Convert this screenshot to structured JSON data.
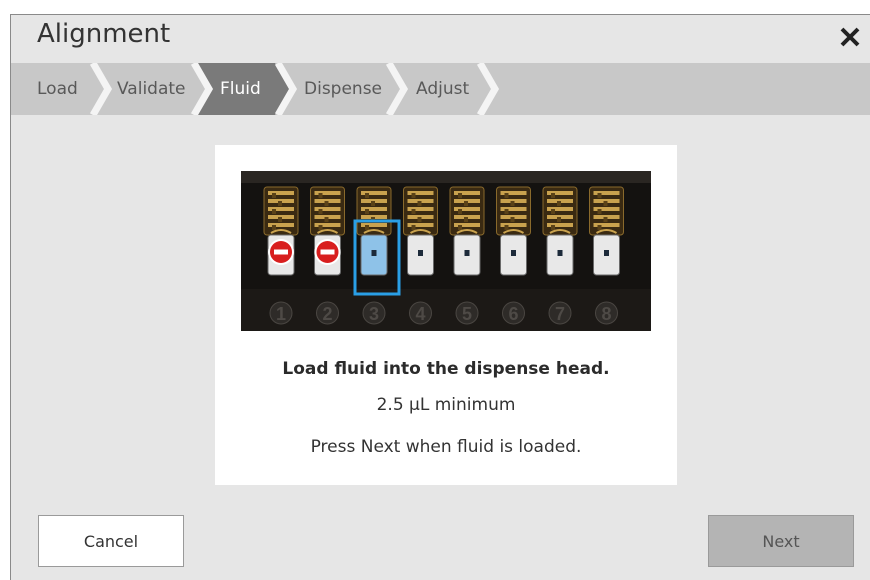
{
  "dialog": {
    "title": "Alignment",
    "close_icon": "close-icon"
  },
  "steps": [
    {
      "label": "Load",
      "state": "done"
    },
    {
      "label": "Validate",
      "state": "done"
    },
    {
      "label": "Fluid",
      "state": "active"
    },
    {
      "label": "Dispense",
      "state": "pending"
    },
    {
      "label": "Adjust",
      "state": "pending"
    }
  ],
  "content": {
    "channels": [
      {
        "number": "1",
        "status": "blocked"
      },
      {
        "number": "2",
        "status": "blocked"
      },
      {
        "number": "3",
        "status": "selected"
      },
      {
        "number": "4",
        "status": "open"
      },
      {
        "number": "5",
        "status": "open"
      },
      {
        "number": "6",
        "status": "open"
      },
      {
        "number": "7",
        "status": "open"
      },
      {
        "number": "8",
        "status": "open"
      }
    ],
    "instruction": "Load fluid into the dispense head.",
    "minimum": "2.5 µL minimum",
    "next_hint": "Press Next when fluid is loaded."
  },
  "buttons": {
    "cancel": "Cancel",
    "next": "Next"
  },
  "colors": {
    "stepbar": "#c8c8c8",
    "step_active": "#7a7a7a",
    "selected_channel": "#2a9fe6"
  }
}
